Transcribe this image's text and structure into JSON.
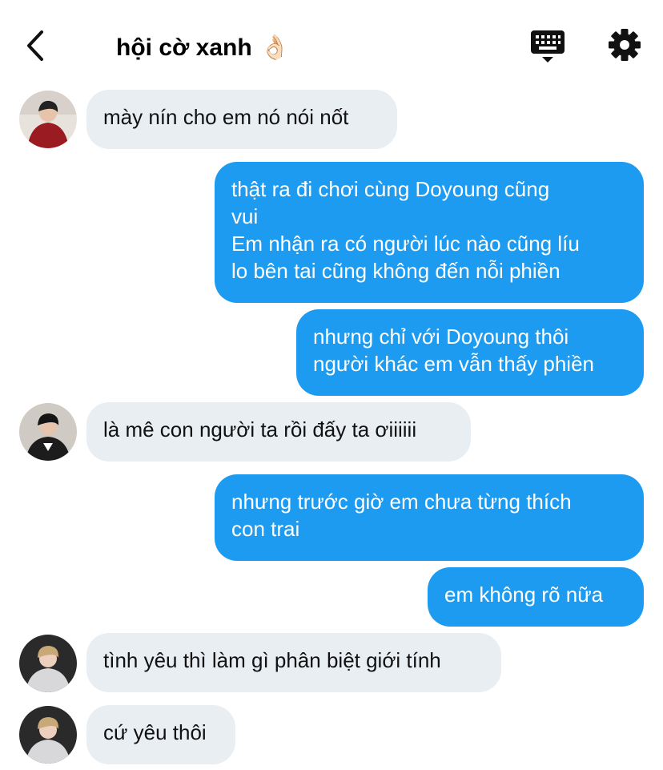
{
  "header": {
    "title": "hội cờ xanh",
    "title_emoji": "👌🏻"
  },
  "icons": {
    "back": "chevron-left-icon",
    "keyboard": "keyboard-icon",
    "settings": "gear-icon"
  },
  "colors": {
    "outgoing_bubble": "#1d9bf0",
    "incoming_bubble": "#e9eef3"
  },
  "messages": [
    {
      "direction": "incoming",
      "text": "mày nín cho em nó nói nốt"
    },
    {
      "direction": "outgoing",
      "lines": [
        "thật ra đi chơi cùng Doyoung cũng",
        "vui",
        "Em nhận ra có người lúc nào cũng líu",
        "lo bên tai cũng không đến nỗi phiền"
      ]
    },
    {
      "direction": "outgoing",
      "lines": [
        "nhưng chỉ với Doyoung thôi",
        "người khác em vẫn thấy phiền"
      ]
    },
    {
      "direction": "incoming",
      "text": "là mê con người ta rồi đấy ta ơiiiiii"
    },
    {
      "direction": "outgoing",
      "lines": [
        "nhưng trước giờ em chưa từng thích",
        "con trai"
      ]
    },
    {
      "direction": "outgoing",
      "text": "em không rõ nữa"
    },
    {
      "direction": "incoming",
      "text": "tình yêu thì làm gì phân biệt giới tính"
    },
    {
      "direction": "incoming",
      "text": "cứ yêu thôi"
    }
  ]
}
